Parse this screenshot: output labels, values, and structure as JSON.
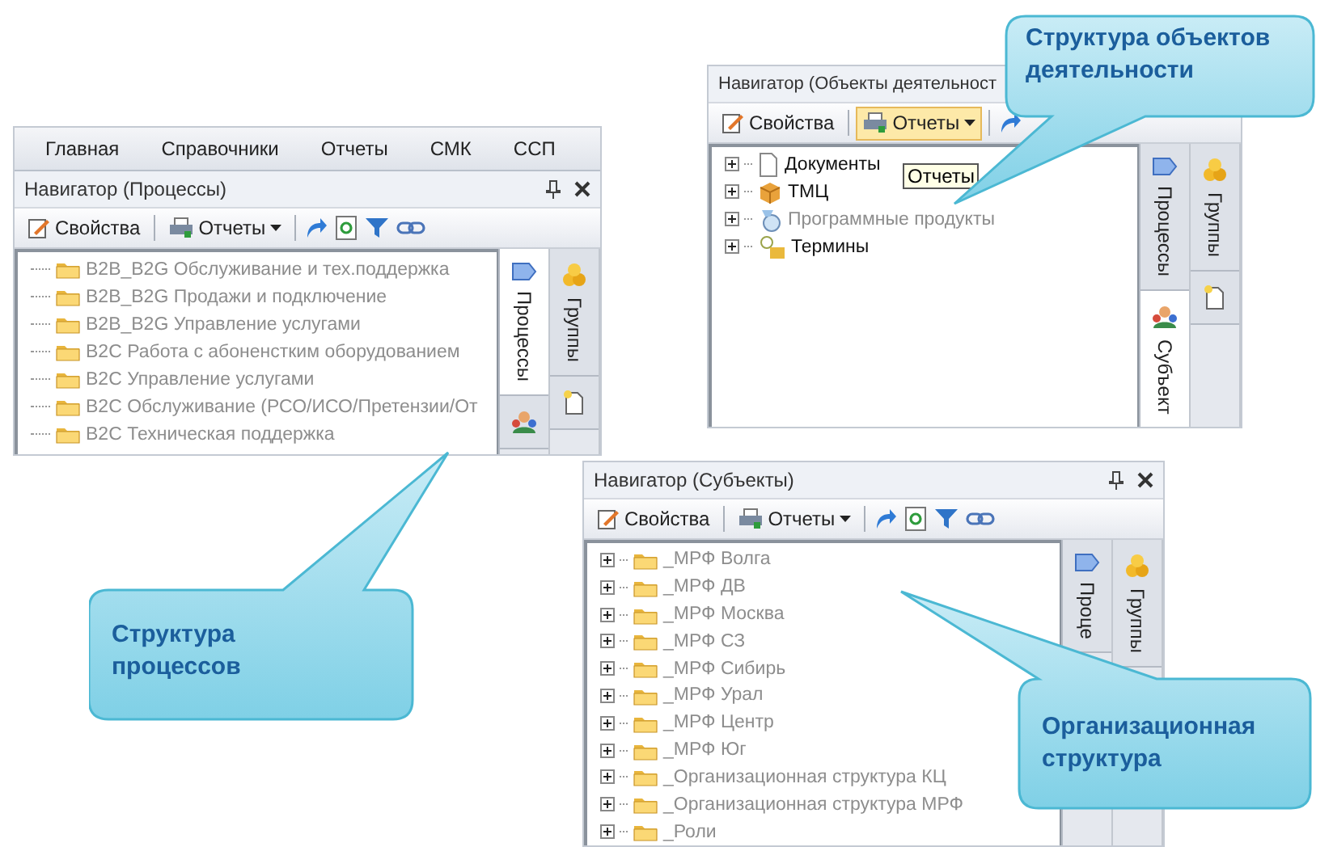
{
  "panels": [
    {
      "menu": [
        "Главная",
        "Справочники",
        "Отчеты",
        "СМК",
        "ССП"
      ],
      "title": "Навигатор (Процессы)",
      "window_buttons": true,
      "toolbar": {
        "properties": "Свойства",
        "reports": "Отчеты",
        "reports_highlighted": false,
        "full_toolbar": true
      },
      "items": [
        {
          "label": "B2B_B2G Обслуживание и тех.поддержка",
          "kind": "folder",
          "greyed": true,
          "expandable": false
        },
        {
          "label": "B2B_B2G Продажи и подключение",
          "kind": "folder",
          "greyed": true,
          "expandable": false
        },
        {
          "label": "B2B_B2G Управление услугами",
          "kind": "folder",
          "greyed": true,
          "expandable": false
        },
        {
          "label": "B2C Работа с абоненстким оборудованием",
          "kind": "folder",
          "greyed": true,
          "expandable": false
        },
        {
          "label": "B2C Управление услугами",
          "kind": "folder",
          "greyed": true,
          "expandable": false
        },
        {
          "label": "B2C Обслуживание (РСО/ИСО/Претензии/От",
          "kind": "folder",
          "greyed": true,
          "expandable": false
        },
        {
          "label": "B2C Техническая поддержка",
          "kind": "folder",
          "greyed": true,
          "expandable": false
        }
      ],
      "side_columns": [
        [
          {
            "label": "Процессы",
            "kind": "process",
            "selected": true
          },
          {
            "kind": "people",
            "selected": false
          }
        ],
        [
          {
            "label": "Группы",
            "kind": "groups",
            "selected": false
          },
          {
            "kind": "newdoc",
            "selected": false
          }
        ]
      ]
    },
    {
      "title": "Навигатор (Объекты деятельност",
      "window_buttons": false,
      "toolbar": {
        "properties": "Свойства",
        "reports": "Отчеты",
        "reports_highlighted": true,
        "full_toolbar": false
      },
      "tooltip": "Отчеты",
      "items": [
        {
          "label": "Документы",
          "kind": "document",
          "greyed": false,
          "expandable": true
        },
        {
          "label": "ТМЦ",
          "kind": "box",
          "greyed": false,
          "expandable": true
        },
        {
          "label": "Программные продукты",
          "kind": "software",
          "greyed": true,
          "expandable": true
        },
        {
          "label": "Термины",
          "kind": "term",
          "greyed": false,
          "expandable": true
        }
      ],
      "side_columns": [
        [
          {
            "label": "Процессы",
            "kind": "process",
            "selected": false
          },
          {
            "label": "Субъект",
            "kind": "people",
            "selected": true
          }
        ],
        [
          {
            "label": "Группы",
            "kind": "groups",
            "selected": false
          },
          {
            "kind": "newdoc",
            "selected": false
          }
        ]
      ]
    },
    {
      "title": "Навигатор (Субъекты)",
      "window_buttons": true,
      "toolbar": {
        "properties": "Свойства",
        "reports": "Отчеты",
        "reports_highlighted": false,
        "full_toolbar": true
      },
      "items": [
        {
          "label": "_МРФ Волга",
          "kind": "folder",
          "greyed": true,
          "expandable": true
        },
        {
          "label": "_МРФ ДВ",
          "kind": "folder",
          "greyed": true,
          "expandable": true
        },
        {
          "label": "_МРФ Москва",
          "kind": "folder",
          "greyed": true,
          "expandable": true
        },
        {
          "label": "_МРФ СЗ",
          "kind": "folder",
          "greyed": true,
          "expandable": true
        },
        {
          "label": "_МРФ Сибирь",
          "kind": "folder",
          "greyed": true,
          "expandable": true
        },
        {
          "label": "_МРФ Урал",
          "kind": "folder",
          "greyed": true,
          "expandable": true
        },
        {
          "label": "_МРФ Центр",
          "kind": "folder",
          "greyed": true,
          "expandable": true
        },
        {
          "label": "_МРФ Юг",
          "kind": "folder",
          "greyed": true,
          "expandable": true
        },
        {
          "label": "_Организационная структура КЦ",
          "kind": "folder",
          "greyed": true,
          "expandable": true
        },
        {
          "label": "_Организационная структура МРФ",
          "kind": "folder",
          "greyed": true,
          "expandable": true
        },
        {
          "label": "_Роли",
          "kind": "folder",
          "greyed": true,
          "expandable": true
        }
      ],
      "side_columns": [
        [
          {
            "label": "Проце",
            "kind": "process",
            "selected": false
          }
        ],
        [
          {
            "label": "Группы",
            "kind": "groups",
            "selected": false
          }
        ]
      ]
    }
  ],
  "callouts": [
    {
      "text": "Структура процессов"
    },
    {
      "text": "Структура объектов деятельности"
    },
    {
      "text": "Организационная структура"
    }
  ]
}
